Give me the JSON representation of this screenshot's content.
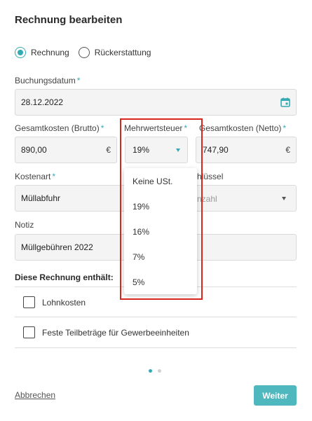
{
  "dialog": {
    "title": "Rechnung bearbeiten"
  },
  "type_radio": {
    "options": [
      {
        "label": "Rechnung",
        "selected": true
      },
      {
        "label": "Rückerstattung",
        "selected": false
      }
    ]
  },
  "required_mark": "*",
  "booking_date": {
    "label": "Buchungsdatum",
    "value": "28.12.2022",
    "icon": "calendar-icon"
  },
  "gross": {
    "label": "Gesamtkosten (Brutto)",
    "value": "890,00",
    "currency": "€"
  },
  "vat": {
    "label": "Mehrwertsteuer",
    "value": "19%",
    "options": [
      "Keine USt.",
      "19%",
      "16%",
      "7%",
      "5%"
    ]
  },
  "net": {
    "label": "Gesamtkosten (Netto)",
    "value": "747,90",
    "currency": "€"
  },
  "cost_type": {
    "label": "Kostenart",
    "value": "Müllabfuhr"
  },
  "key": {
    "label_partial": "hlüssel",
    "value_partial": "nzahl"
  },
  "note": {
    "label": "Notiz",
    "value": "Müllgebühren 2022"
  },
  "contains": {
    "title": "Diese Rechnung enthält:",
    "items": [
      {
        "label": "Lohnkosten",
        "checked": false
      },
      {
        "label": "Feste Teilbeträge für Gewerbeeinheiten",
        "checked": false
      }
    ]
  },
  "pagination": {
    "current": 1,
    "total": 2,
    "active_color": "#35aab3",
    "inactive_color": "#d0d0d0"
  },
  "footer": {
    "cancel_label": "Abbrechen",
    "next_label": "Weiter"
  },
  "colors": {
    "accent": "#35aab3",
    "highlight_border": "#d9261c"
  }
}
